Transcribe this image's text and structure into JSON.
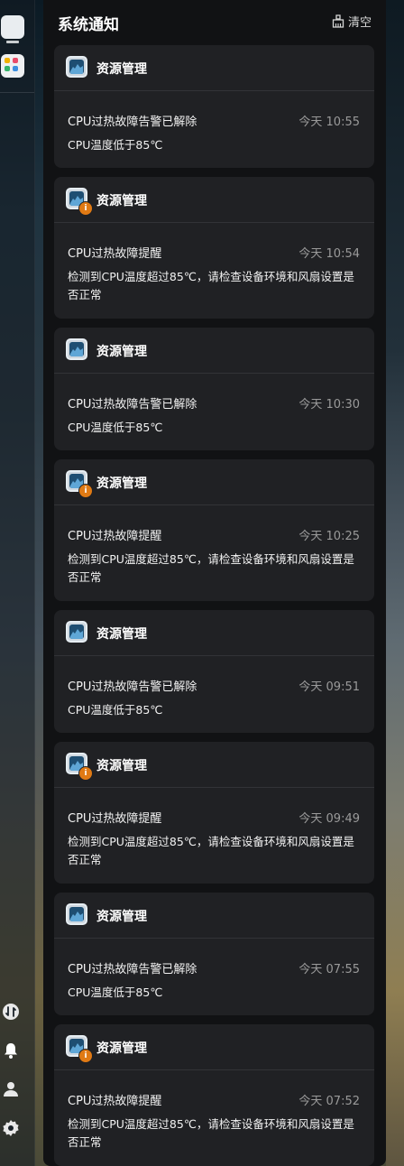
{
  "panel": {
    "title": "系统通知",
    "clear_label": "清空"
  },
  "notifications": [
    {
      "app": "资源管理",
      "type": "resolved",
      "title": "CPU过热故障告警已解除",
      "time": "今天 10:55",
      "desc": "CPU温度低于85℃"
    },
    {
      "app": "资源管理",
      "type": "warning",
      "title": "CPU过热故障提醒",
      "time": "今天 10:54",
      "desc": "检测到CPU温度超过85℃，请检查设备环境和风扇设置是否正常"
    },
    {
      "app": "资源管理",
      "type": "resolved",
      "title": "CPU过热故障告警已解除",
      "time": "今天 10:30",
      "desc": "CPU温度低于85℃"
    },
    {
      "app": "资源管理",
      "type": "warning",
      "title": "CPU过热故障提醒",
      "time": "今天 10:25",
      "desc": "检测到CPU温度超过85℃，请检查设备环境和风扇设置是否正常"
    },
    {
      "app": "资源管理",
      "type": "resolved",
      "title": "CPU过热故障告警已解除",
      "time": "今天 09:51",
      "desc": "CPU温度低于85℃"
    },
    {
      "app": "资源管理",
      "type": "warning",
      "title": "CPU过热故障提醒",
      "time": "今天 09:49",
      "desc": "检测到CPU温度超过85℃，请检查设备环境和风扇设置是否正常"
    },
    {
      "app": "资源管理",
      "type": "resolved",
      "title": "CPU过热故障告警已解除",
      "time": "今天 07:55",
      "desc": "CPU温度低于85℃"
    },
    {
      "app": "资源管理",
      "type": "warning",
      "title": "CPU过热故障提醒",
      "time": "今天 07:52",
      "desc": "检测到CPU温度超过85℃，请检查设备环境和风扇设置是否正常"
    }
  ],
  "badge_symbol": "i",
  "dock": {
    "apps": [
      "monitor-app-icon",
      "palette-app-icon"
    ],
    "bottom_icons": [
      "transfer-icon",
      "bell-icon",
      "user-icon",
      "gear-icon"
    ]
  },
  "colors": {
    "panel_bg": "#111214",
    "card_bg": "#202124",
    "warning_badge": "#e07a14",
    "time_text": "#9a9a9a"
  }
}
